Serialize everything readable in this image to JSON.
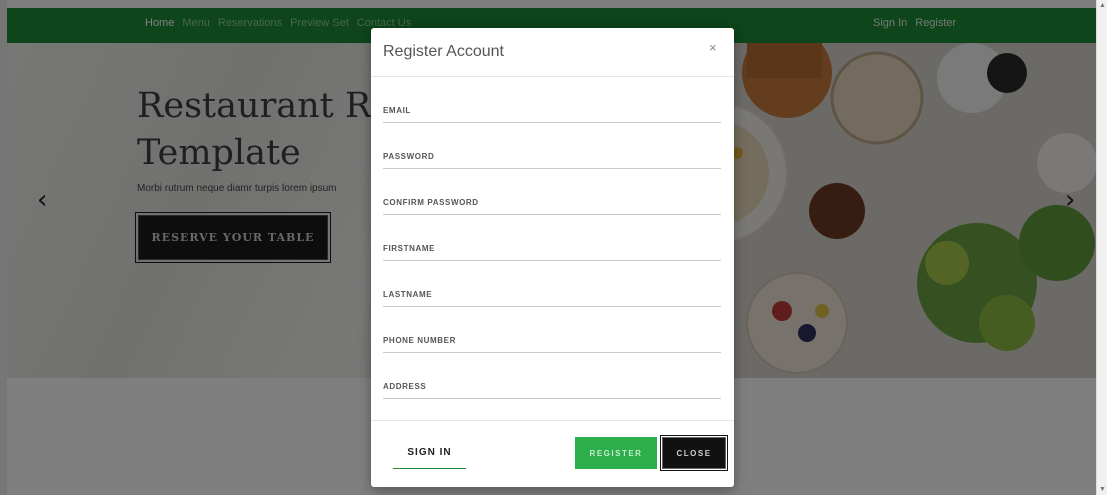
{
  "navbar": {
    "links": [
      "Home",
      "Menu",
      "Reservations",
      "Preview Set",
      "Contact Us"
    ],
    "right_links": [
      "Sign In",
      "Register"
    ]
  },
  "hero": {
    "title_line1": "Restaurant Re",
    "title_line2": "Template",
    "text": "Morbi rutrum neque diamr turpis lorem ipsum",
    "reserve_label": "RESERVE YOUR TABLE",
    "prev_arrow": "‹",
    "next_arrow": "›"
  },
  "modal": {
    "title": "Register Account",
    "close_symbol": "×",
    "fields": [
      {
        "label": "EMAIL"
      },
      {
        "label": "PASSWORD"
      },
      {
        "label": "CONFIRM PASSWORD"
      },
      {
        "label": "FIRSTNAME"
      },
      {
        "label": "LASTNAME"
      },
      {
        "label": "PHONE NUMBER"
      },
      {
        "label": "ADDRESS"
      }
    ],
    "footer": {
      "signin_label": "SIGN IN",
      "register_label": "REGISTER",
      "close_label": "CLOSE"
    }
  },
  "scrollbar": {
    "up": "▲",
    "down": "▼"
  },
  "colors": {
    "brand_green": "#1c8a34",
    "register_green": "#2cae4b",
    "dark_button": "#111111"
  }
}
